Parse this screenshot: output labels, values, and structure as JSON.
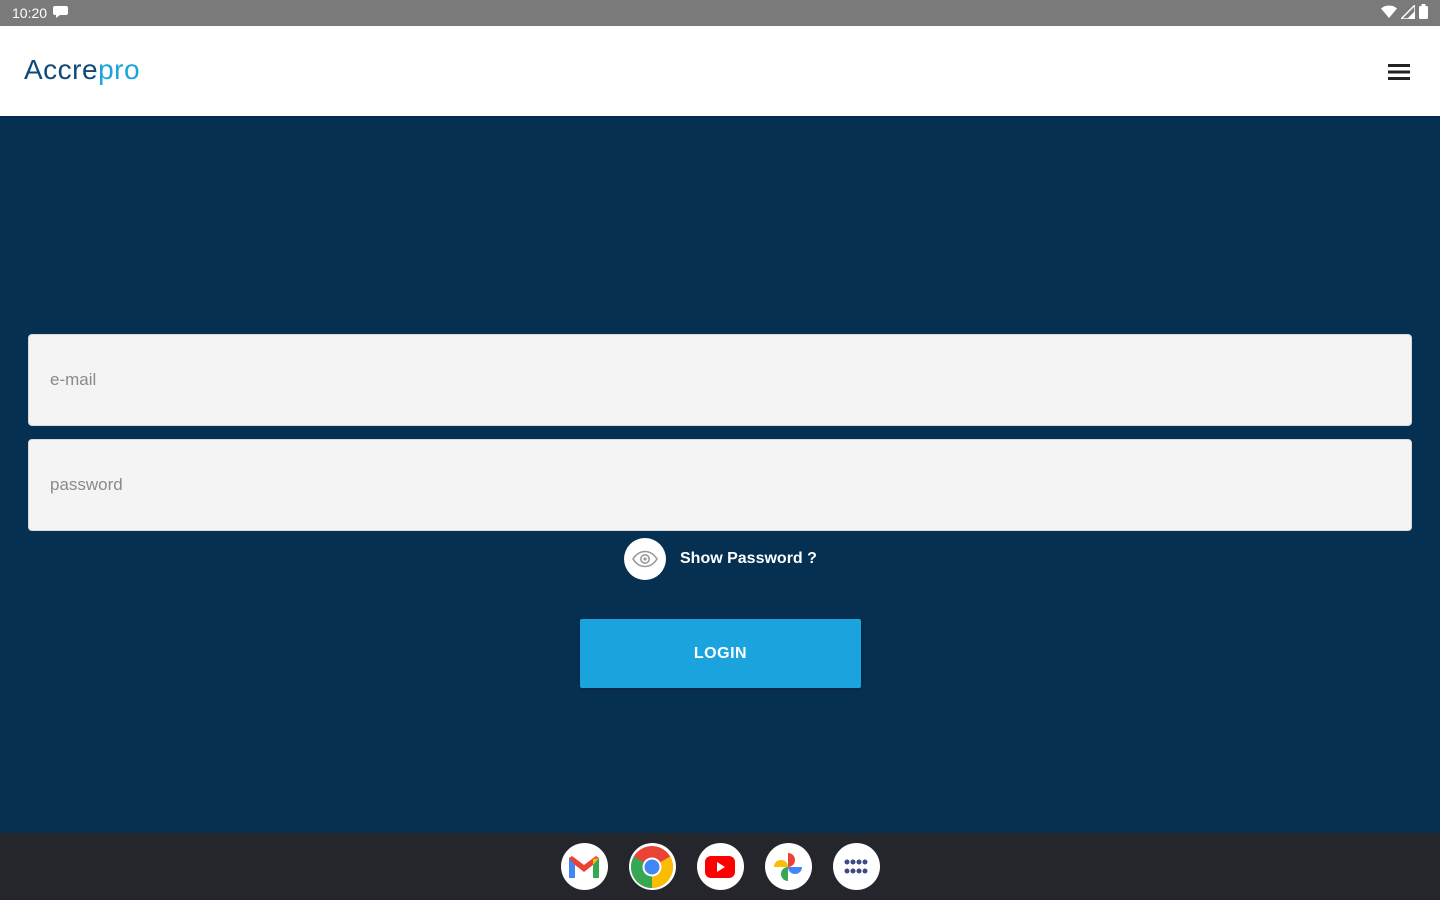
{
  "status_bar": {
    "time": "10:20",
    "icons": [
      "chat-bubble-icon",
      "wifi-icon",
      "signal-icon",
      "battery-icon"
    ]
  },
  "header": {
    "logo_text_a": "Accre",
    "logo_text_b": "pro",
    "menu_icon": "hamburger-menu-icon"
  },
  "form": {
    "email": {
      "placeholder": "e-mail",
      "value": ""
    },
    "password": {
      "placeholder": "password",
      "value": ""
    },
    "show_password_label": "Show Password ?",
    "login_label": "LOGIN"
  },
  "dock": {
    "apps": [
      "gmail-icon",
      "chrome-icon",
      "youtube-icon",
      "photos-icon",
      "app-drawer-icon"
    ]
  },
  "colors": {
    "brand_navy": "#063052",
    "accent_blue": "#1ba3de",
    "logo_text": "#0e4a7a",
    "field_bg": "#f4f4f4",
    "status_bar": "#7a7a7a",
    "dock_bg": "#24262b"
  }
}
